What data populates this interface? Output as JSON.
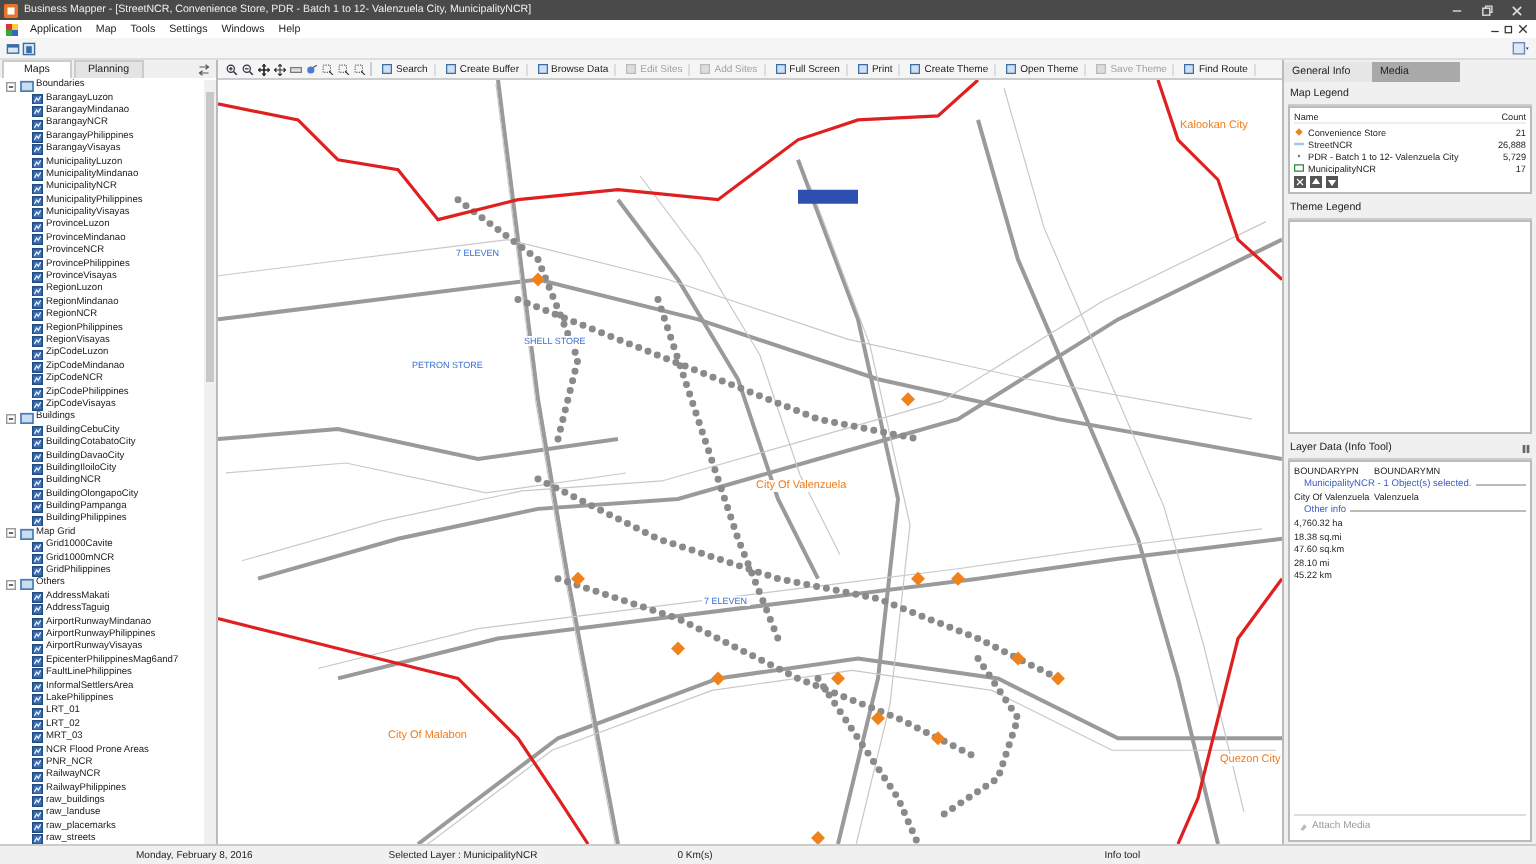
{
  "window": {
    "title": "Business Mapper - [StreetNCR, Convenience Store, PDR - Batch 1 to 12- Valenzuela City, MunicipalityNCR]"
  },
  "menu": [
    "Application",
    "Map",
    "Tools",
    "Settings",
    "Windows",
    "Help"
  ],
  "left_tabs": [
    {
      "label": "Maps",
      "selected": true
    },
    {
      "label": "Planning",
      "selected": false
    }
  ],
  "toolbar": [
    {
      "label": "Search",
      "disabled": false
    },
    {
      "label": "Create Buffer",
      "disabled": false
    },
    {
      "label": "Browse Data",
      "disabled": false
    },
    {
      "label": "Edit Sites",
      "disabled": true
    },
    {
      "label": "Add Sites",
      "disabled": true
    },
    {
      "label": "Full Screen",
      "disabled": false
    },
    {
      "label": "Print",
      "disabled": false
    },
    {
      "label": "Create Theme",
      "disabled": false
    },
    {
      "label": "Open Theme",
      "disabled": false
    },
    {
      "label": "Save Theme",
      "disabled": true
    },
    {
      "label": "Find Route",
      "disabled": false
    }
  ],
  "layer_tree": [
    {
      "label": "Boundaries",
      "expanded": true,
      "children": [
        "BarangayLuzon",
        "BarangayMindanao",
        "BarangayNCR",
        "BarangayPhilippines",
        "BarangayVisayas",
        "MunicipalityLuzon",
        "MunicipalityMindanao",
        "MunicipalityNCR",
        "MunicipalityPhilippines",
        "MunicipalityVisayas",
        "ProvinceLuzon",
        "ProvinceMindanao",
        "ProvinceNCR",
        "ProvincePhilippines",
        "ProvinceVisayas",
        "RegionLuzon",
        "RegionMindanao",
        "RegionNCR",
        "RegionPhilippines",
        "RegionVisayas",
        "ZipCodeLuzon",
        "ZipCodeMindanao",
        "ZipCodeNCR",
        "ZipCodePhilippines",
        "ZipCodeVisayas"
      ]
    },
    {
      "label": "Buildings",
      "expanded": true,
      "children": [
        "BuildingCebuCity",
        "BuildingCotabatoCity",
        "BuildingDavaoCity",
        "BuildingIloiloCity",
        "BuildingNCR",
        "BuildingOlongapoCity",
        "BuildingPampanga",
        "BuildingPhilippines"
      ]
    },
    {
      "label": "Map Grid",
      "expanded": true,
      "children": [
        "Grid1000Cavite",
        "Grid1000mNCR",
        "GridPhilippines"
      ]
    },
    {
      "label": "Others",
      "expanded": true,
      "children": [
        "AddressMakati",
        "AddressTaguig",
        "AirportRunwayMindanao",
        "AirportRunwayPhilippines",
        "AirportRunwayVisayas",
        "EpicenterPhilippinesMag6and7",
        "FaultLinePhilippines",
        "InformalSettlersArea",
        "LakePhilippines",
        "LRT_01",
        "LRT_02",
        "MRT_03",
        "NCR Flood Prone Areas",
        "PNR_NCR",
        "RailwayNCR",
        "RailwayPhilippines",
        "raw_buildings",
        "raw_landuse",
        "raw_placemarks",
        "raw_streets"
      ]
    }
  ],
  "map_labels": [
    {
      "text": "Kalookan City",
      "kind": "city"
    },
    {
      "text": "City Of Valenzuela",
      "kind": "city"
    },
    {
      "text": "City Of Malabon",
      "kind": "city"
    },
    {
      "text": "Quezon City",
      "kind": "city"
    },
    {
      "text": "7 ELEVEN",
      "kind": "store"
    },
    {
      "text": "PETRON STORE",
      "kind": "store"
    },
    {
      "text": "SHELL STORE",
      "kind": "store"
    },
    {
      "text": "7 ELEVEN",
      "kind": "store"
    }
  ],
  "right_tabs": [
    {
      "label": "General Info",
      "selected": true
    },
    {
      "label": "Media",
      "selected": false
    }
  ],
  "map_legend": {
    "title": "Map Legend",
    "columns": [
      "Name",
      "Count"
    ],
    "rows": [
      {
        "kind": "point",
        "name": "Convenience Store",
        "count": "21"
      },
      {
        "kind": "line",
        "name": "StreetNCR",
        "count": "26,888"
      },
      {
        "kind": "dot",
        "name": "PDR - Batch 1 to 12- Valenzuela City",
        "count": "5,729"
      },
      {
        "kind": "polygon",
        "name": "MunicipalityNCR",
        "count": "17"
      }
    ]
  },
  "theme_legend": {
    "title": "Theme Legend"
  },
  "layer_data": {
    "title": "Layer Data (Info Tool)",
    "columns": [
      "BOUNDARYPN",
      "BOUNDARYMN"
    ],
    "selection": "MunicipalityNCR - 1 Object(s) selected.",
    "values": [
      "City Of Valenzuela",
      "Valenzuela"
    ],
    "other_title": "Other info",
    "other": [
      "4,760.32 ha",
      "18.38 sq.mi",
      "47.60 sq.km",
      "28.10 mi",
      "45.22 km"
    ],
    "button": "Attach Media"
  },
  "status_bar": [
    "Monday, February 8, 2016",
    "Selected Layer : MunicipalityNCR",
    "0 Km(s)",
    "Info tool"
  ]
}
